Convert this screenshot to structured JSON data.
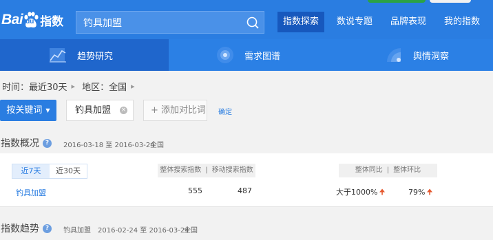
{
  "header": {
    "logo": {
      "bai": "Bai",
      "du": "du",
      "zhishu": "指数"
    },
    "search": {
      "value": "钓具加盟",
      "placeholder": ""
    },
    "nav": [
      "指数探索",
      "数说专题",
      "品牌表现",
      "我的指数"
    ],
    "colors": {
      "primary": "#2a7de1",
      "active_nav": "#1758bd"
    }
  },
  "subnav": {
    "tabs": [
      {
        "label": "趋势研究",
        "icon": "trend-chart-icon"
      },
      {
        "label": "需求图谱",
        "icon": "demand-graph-icon"
      },
      {
        "label": "舆情洞察",
        "icon": "sentiment-icon"
      }
    ]
  },
  "filters": {
    "time_label": "时间：最近30天",
    "region_label": "地区：全国",
    "keyword_button": "按关键词",
    "keyword_value": "钓具加盟",
    "add_compare": "添加对比词",
    "confirm": "确定"
  },
  "overview": {
    "title": "指数概况",
    "date_range": "2016-03-18 至 2016-03-24",
    "region": "全国",
    "range_options": [
      "近7天",
      "近30天"
    ],
    "search_headers": [
      "整体搜索指数",
      "移动搜索指数"
    ],
    "compare_headers": [
      "整体同比",
      "整体环比"
    ],
    "row": {
      "keyword": "钓具加盟",
      "overall_search": "555",
      "mobile_search": "487",
      "yoy": "大于1000%",
      "mom": "79%"
    }
  },
  "trend": {
    "title": "指数趋势",
    "keyword": "钓具加盟",
    "date_range": "2016-02-24 至 2016-03-24",
    "region": "全国"
  }
}
